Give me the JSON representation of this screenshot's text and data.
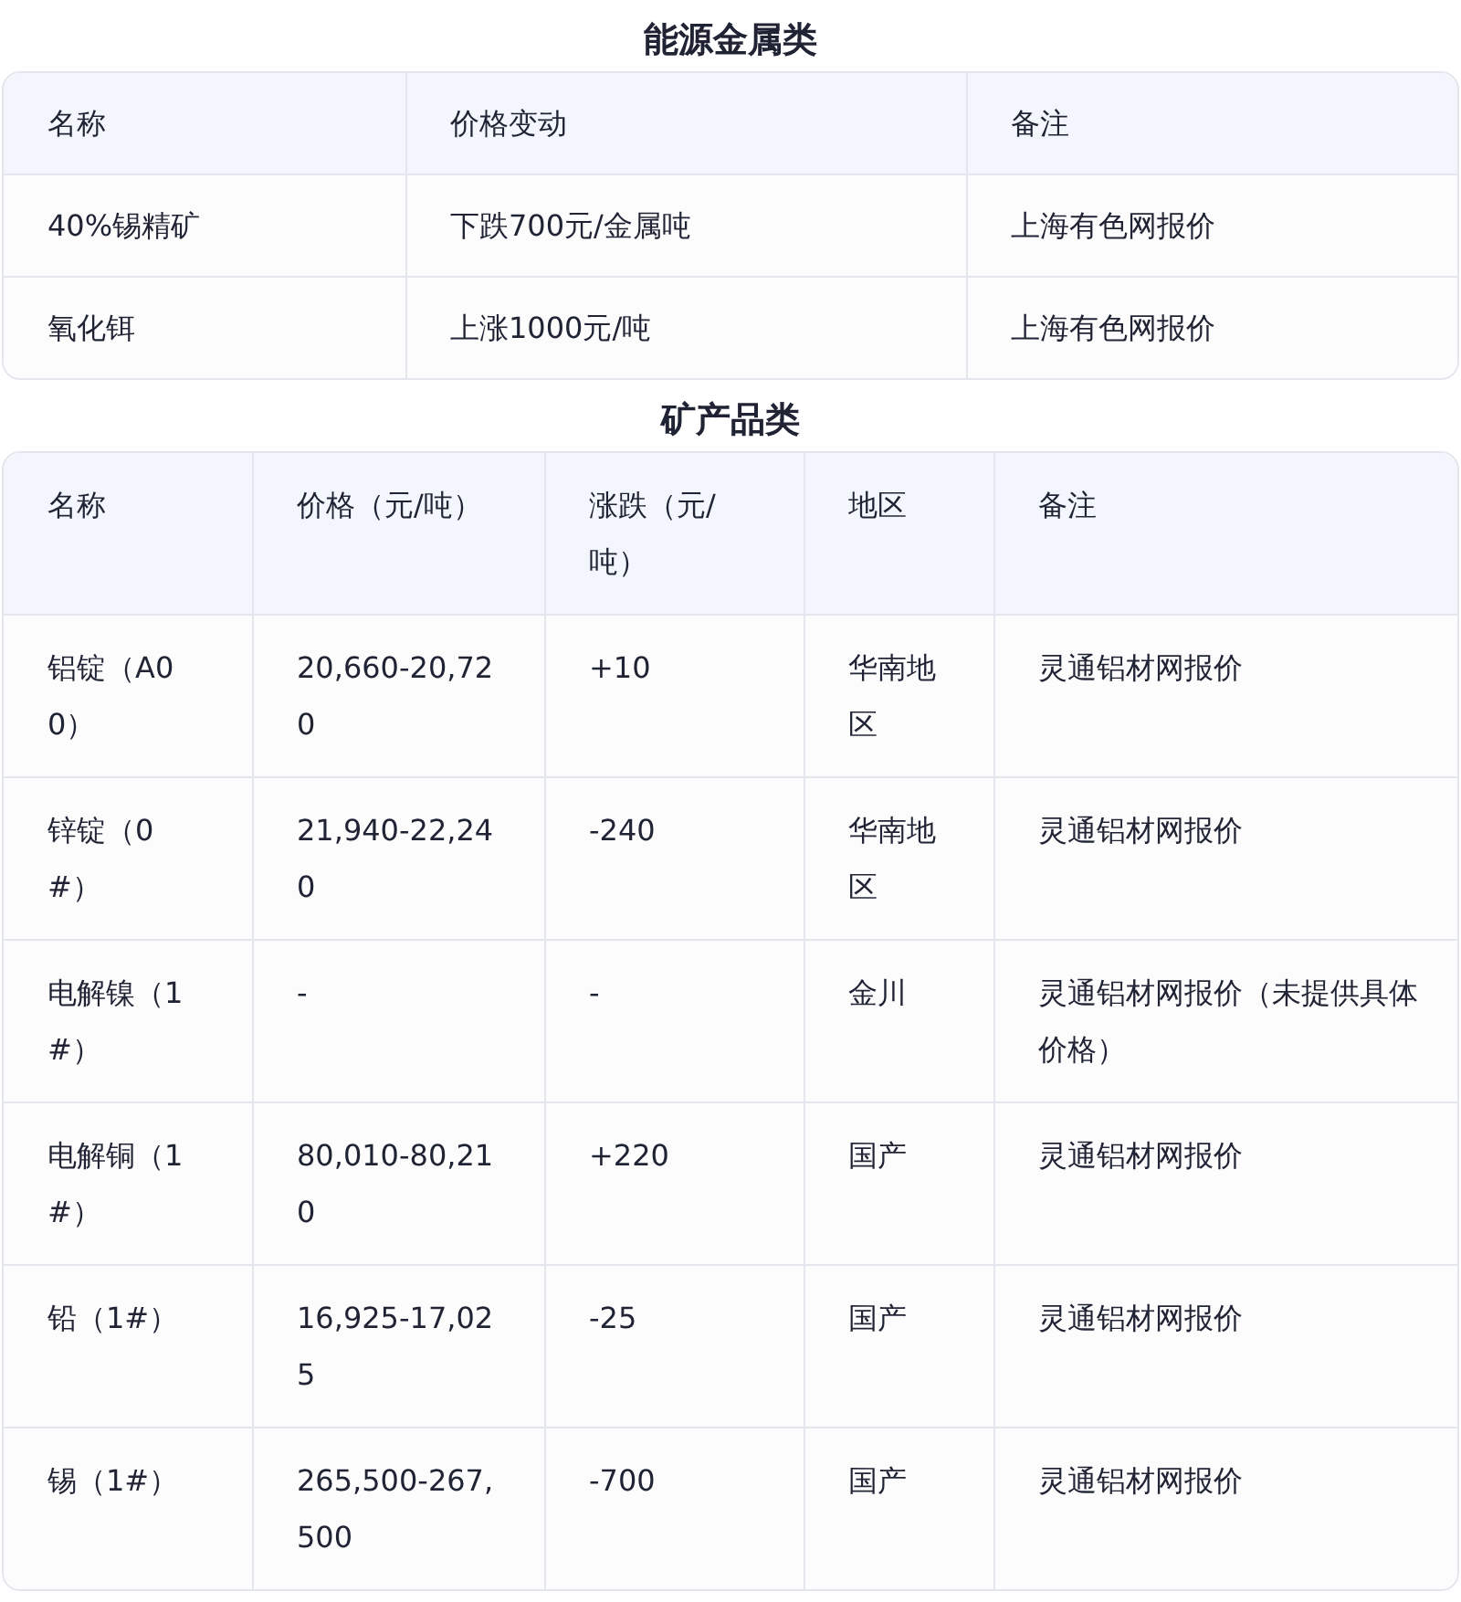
{
  "sections": [
    {
      "title": "能源金属类",
      "columns": [
        "名称",
        "价格变动",
        "备注"
      ],
      "rows": [
        [
          "40%锡精矿",
          "下跌700元/金属吨",
          "上海有色网报价"
        ],
        [
          "氧化铒",
          "上涨1000元/吨",
          "上海有色网报价"
        ]
      ]
    },
    {
      "title": "矿产品类",
      "columns": [
        "名称",
        "价格（元/吨）",
        "涨跌（元/吨）",
        "地区",
        "备注"
      ],
      "rows": [
        [
          "铝锭（A00）",
          "20,660-20,720",
          "+10",
          "华南地区",
          "灵通铝材网报价"
        ],
        [
          "锌锭（0#）",
          "21,940-22,240",
          "-240",
          "华南地区",
          "灵通铝材网报价"
        ],
        [
          "电解镍（1#）",
          "-",
          "-",
          "金川",
          "灵通铝材网报价（未提供具体价格）"
        ],
        [
          "电解铜（1#）",
          "80,010-80,210",
          "+220",
          "国产",
          "灵通铝材网报价"
        ],
        [
          "铅（1#）",
          "16,925-17,025",
          "-25",
          "国产",
          "灵通铝材网报价"
        ],
        [
          "锡（1#）",
          "265,500-267,500",
          "-700",
          "国产",
          "灵通铝材网报价"
        ]
      ]
    }
  ]
}
